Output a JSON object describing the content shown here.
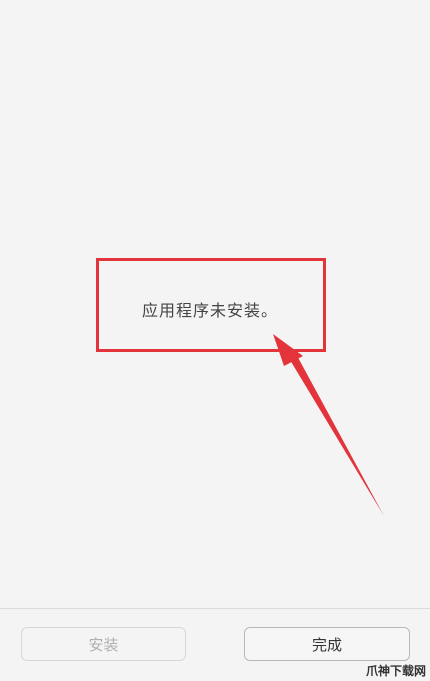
{
  "message": "应用程序未安装。",
  "buttons": {
    "install_label": "安装",
    "done_label": "完成"
  },
  "watermark": "爪神下载网",
  "colors": {
    "highlight": "#e3333b",
    "background": "#f4f4f4",
    "disabled_text": "#b0b0b0"
  }
}
